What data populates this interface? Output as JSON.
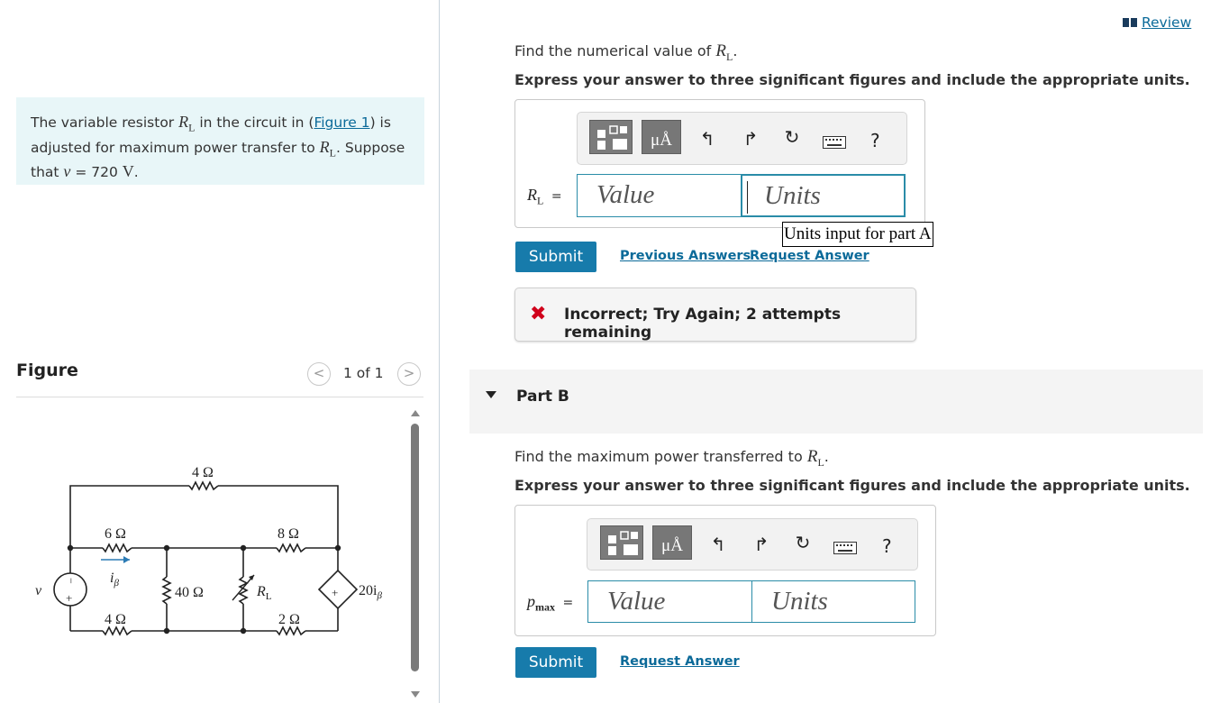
{
  "problem": {
    "text_1": "The variable resistor ",
    "text_2": " in the circuit in (",
    "figure_link": "Figure 1",
    "text_3": ") is adjusted for maximum power transfer to ",
    "text_4": ". Suppose that ",
    "var_v": "v",
    "text_5": " = 720 ",
    "unit_v": "V",
    "text_6": ".",
    "rl_symbol": "R",
    "rl_sub": "L"
  },
  "figure": {
    "title": "Figure",
    "pager": "1 of 1",
    "prev": "<",
    "next": ">"
  },
  "circuit": {
    "r_top": "4 Ω",
    "r_6": "6 Ω",
    "r_8": "8 Ω",
    "r_40": "40 Ω",
    "r_bottom_left": "4 Ω",
    "r_2": "2 Ω",
    "rl": "R",
    "rl_sub": "L",
    "i_beta": "i",
    "beta": "β",
    "src_dep": "20i",
    "src_v": "v",
    "plus": "+",
    "minus": "−"
  },
  "review": "Review",
  "part_a": {
    "prompt_1": "Find the numerical value of ",
    "prompt_sym": "R",
    "prompt_sub": "L",
    "prompt_end": ".",
    "instruction": "Express your answer to three significant figures and include the appropriate units.",
    "label_sym": "R",
    "label_sub": "L",
    "label_eq": "=",
    "value_placeholder": "Value",
    "units_placeholder": "Units",
    "tooltip": "Units input for part A",
    "submit": "Submit",
    "previous_answers": "Previous Answers",
    "request_answer": "Request Answer",
    "feedback": "Incorrect; Try Again; 2 attempts remaining",
    "units_btn": "μÅ",
    "help": "?"
  },
  "part_b": {
    "header": "Part B",
    "prompt_1": "Find the maximum power transferred to ",
    "prompt_sym": "R",
    "prompt_sub": "L",
    "prompt_end": ".",
    "instruction": "Express your answer to three significant figures and include the appropriate units.",
    "label_sym": "p",
    "label_sub": "max",
    "label_eq": "=",
    "value_placeholder": "Value",
    "units_placeholder": "Units",
    "submit": "Submit",
    "request_answer": "Request Answer",
    "units_btn": "μÅ",
    "help": "?"
  },
  "colors": {
    "accent": "#177bab",
    "link": "#0b6a99",
    "problem_bg": "#e8f6f8",
    "error": "#d0021b"
  }
}
